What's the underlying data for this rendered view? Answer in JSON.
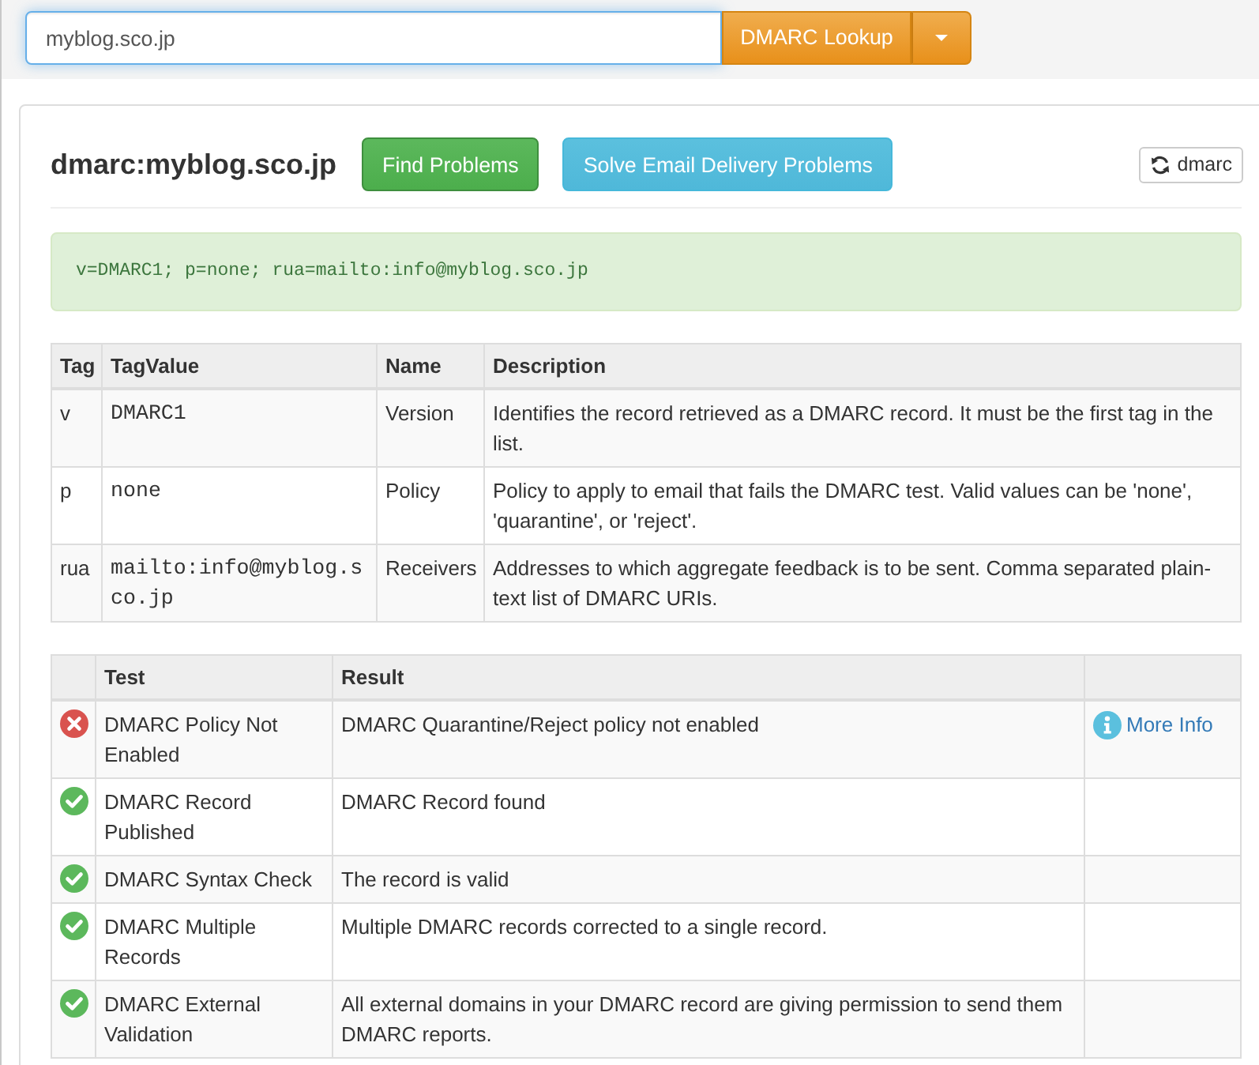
{
  "search": {
    "value": "myblog.sco.jp"
  },
  "lookup_button": {
    "label": "DMARC Lookup"
  },
  "record_title": "dmarc:myblog.sco.jp",
  "action_buttons": [
    {
      "label": "Find Problems",
      "kind": "success"
    },
    {
      "label": "Solve Email Delivery Problems",
      "kind": "info"
    }
  ],
  "refresh_button": {
    "label": "dmarc"
  },
  "record_text": "v=DMARC1; p=none; rua=mailto:info@myblog.sco.jp",
  "tag_table": {
    "columns": [
      "Tag",
      "TagValue",
      "Name",
      "Description"
    ],
    "rows": [
      {
        "tag": "v",
        "value": "DMARC1",
        "name": "Version",
        "description": "Identifies the record retrieved as a DMARC record. It must be the first tag in the list."
      },
      {
        "tag": "p",
        "value": "none",
        "name": "Policy",
        "description": "Policy to apply to email that fails the DMARC test. Valid values can be 'none', 'quarantine', or 'reject'."
      },
      {
        "tag": "rua",
        "value": "mailto:info@myblog.sco.jp",
        "name": "Receivers",
        "description": "Addresses to which aggregate feedback is to be sent. Comma separated plain-text list of DMARC URIs."
      }
    ]
  },
  "test_table": {
    "columns": [
      "Test",
      "Result"
    ],
    "rows": [
      {
        "kind": "error",
        "test": "DMARC Policy Not Enabled",
        "result": "DMARC Quarantine/Reject policy not enabled",
        "link": "More Info"
      },
      {
        "kind": "pass",
        "test": "DMARC Record Published",
        "result": "DMARC Record found"
      },
      {
        "kind": "pass",
        "test": "DMARC Syntax Check",
        "result": "The record is valid"
      },
      {
        "kind": "pass",
        "test": "DMARC Multiple Records",
        "result": "Multiple DMARC records corrected to a single record."
      },
      {
        "kind": "pass",
        "test": "DMARC External Validation",
        "result": "All external domains in your DMARC record are giving permission to send them DMARC reports."
      }
    ]
  }
}
